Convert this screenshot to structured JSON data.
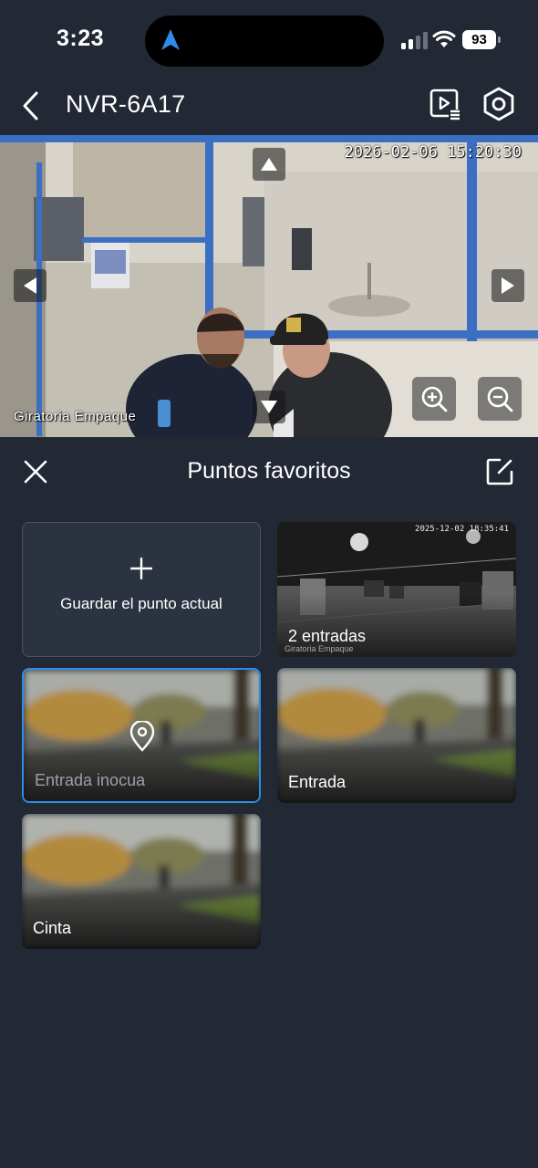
{
  "status_bar": {
    "time": "3:23",
    "battery": "93"
  },
  "header": {
    "title": "NVR-6A17"
  },
  "video": {
    "timestamp": "2026-02-06 15:20:30",
    "camera_name": "Giratoria Empaque"
  },
  "panel": {
    "title": "Puntos favoritos",
    "add_label": "Guardar el punto actual",
    "presets": [
      {
        "label": "2 entradas",
        "timestamp": "2025-12-02 18:35:41",
        "camera_name": "Giratoria Empaque"
      },
      {
        "label": "Entrada inocua"
      },
      {
        "label": "Entrada"
      },
      {
        "label": "Cinta"
      }
    ]
  },
  "colors": {
    "background": "#222834",
    "card_add_bg": "#2b3341",
    "selected_border": "#2f8ce8",
    "nav_arrow": "#2f8ce8"
  }
}
